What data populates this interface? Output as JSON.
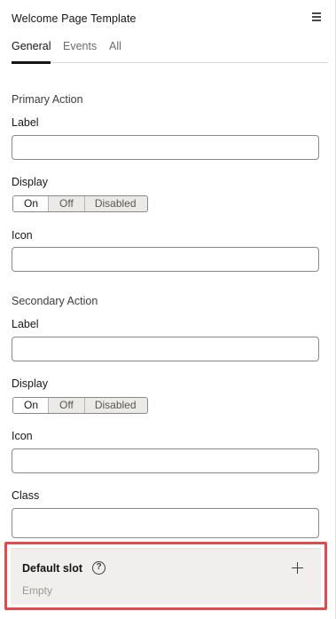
{
  "header": {
    "title": "Welcome Page Template",
    "menu_icon": "hamburger-menu-icon"
  },
  "tabs": [
    {
      "label": "General",
      "active": true
    },
    {
      "label": "Events",
      "active": false
    },
    {
      "label": "All",
      "active": false
    }
  ],
  "primary": {
    "section_title": "Primary Action",
    "label_field": {
      "label": "Label",
      "value": ""
    },
    "display": {
      "label": "Display",
      "options": [
        "On",
        "Off",
        "Disabled"
      ],
      "selected": "On"
    },
    "icon_field": {
      "label": "Icon",
      "value": ""
    }
  },
  "secondary": {
    "section_title": "Secondary Action",
    "label_field": {
      "label": "Label",
      "value": ""
    },
    "display": {
      "label": "Display",
      "options": [
        "On",
        "Off",
        "Disabled"
      ],
      "selected": "On"
    },
    "icon_field": {
      "label": "Icon",
      "value": ""
    },
    "class_field": {
      "label": "Class",
      "value": ""
    }
  },
  "default_slot": {
    "title": "Default slot",
    "help_icon": "question-circle-icon",
    "help_glyph": "?",
    "empty_text": "Empty",
    "add_icon": "plus-icon"
  },
  "colors": {
    "highlight": "#e04b4b",
    "slot_bg": "#f1efed"
  }
}
